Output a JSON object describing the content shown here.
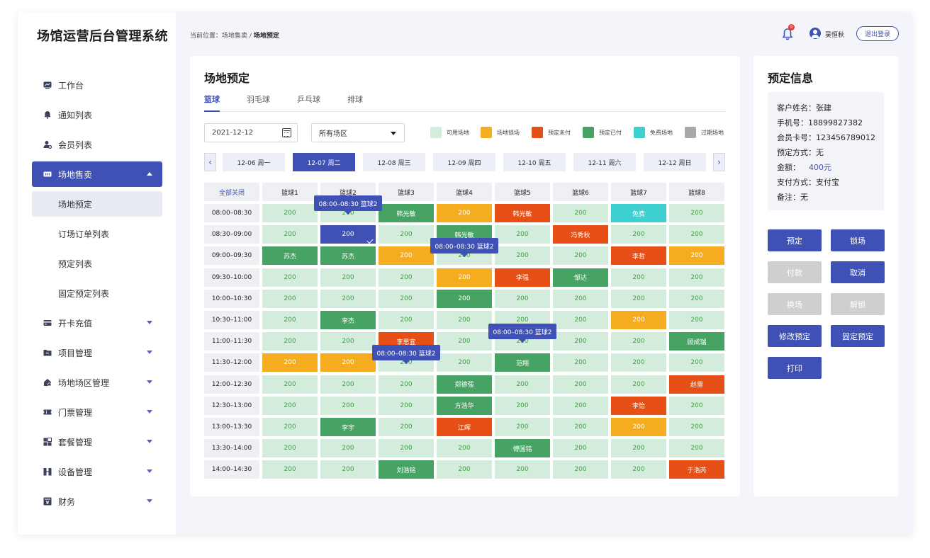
{
  "app": {
    "title": "场馆运营后台管理系统"
  },
  "sidebar": {
    "items": [
      {
        "label": "工作台",
        "icon": "dashboard-icon"
      },
      {
        "label": "通知列表",
        "icon": "bell-icon"
      },
      {
        "label": "会员列表",
        "icon": "member-icon"
      },
      {
        "label": "场地售卖",
        "icon": "ticket-card-icon",
        "active": true
      },
      {
        "label": "开卡充值",
        "icon": "card-icon"
      },
      {
        "label": "项目管理",
        "icon": "folder-icon"
      },
      {
        "label": "场地场区管理",
        "icon": "venue-icon"
      },
      {
        "label": "门票管理",
        "icon": "ticket-icon"
      },
      {
        "label": "套餐管理",
        "icon": "package-icon"
      },
      {
        "label": "设备管理",
        "icon": "device-icon"
      },
      {
        "label": "财务",
        "icon": "finance-icon"
      }
    ],
    "subitems": [
      {
        "label": "场地预定",
        "active": true
      },
      {
        "label": "订场订单列表"
      },
      {
        "label": "预定列表"
      },
      {
        "label": "固定预定列表"
      }
    ]
  },
  "header": {
    "breadcrumb_prefix": "当前位置：",
    "breadcrumb_parent": "场地售卖",
    "breadcrumb_sep": "/",
    "breadcrumb_current": "场地预定",
    "notification_count": "9",
    "user_name": "吴恒秋",
    "logout_label": "退出登录"
  },
  "main": {
    "title": "场地预定",
    "tabs": [
      "篮球",
      "羽毛球",
      "乒乓球",
      "排球"
    ],
    "date_value": "2021-12-12",
    "area_value": "所有场区",
    "legend": [
      {
        "label": "可用场地",
        "color": "#d4ecdc"
      },
      {
        "label": "场地锁场",
        "color": "#f5ac1e"
      },
      {
        "label": "预定未付",
        "color": "#e65016"
      },
      {
        "label": "预定已付",
        "color": "#46a364"
      },
      {
        "label": "免费场地",
        "color": "#3ecfd0"
      },
      {
        "label": "过期场地",
        "color": "#a9a9a9"
      }
    ],
    "prev_day": "‹",
    "next_day": "›",
    "days": [
      "12-06 周一",
      "12-07 周二",
      "12-08 周三",
      "12-09 周四",
      "12-10 周五",
      "12-11 周六",
      "12-12 周日"
    ],
    "active_day": 1,
    "grid": {
      "close_all": "全部关闭",
      "courts": [
        "篮球1",
        "篮球2",
        "篮球3",
        "篮球4",
        "篮球5",
        "篮球6",
        "篮球7",
        "篮球8"
      ],
      "times": [
        "08:00–08:30",
        "08:30–09:00",
        "09:00–09:30",
        "09:30–10:00",
        "10:00–10:30",
        "10:30–11:00",
        "11:00–11:30",
        "11:30–12:00",
        "12:00–12:30",
        "12:30–13:00",
        "13:00–13:30",
        "13:30–14:00",
        "14:00–14:30"
      ],
      "rows": [
        [
          [
            "a",
            "200"
          ],
          [
            "a",
            "200"
          ],
          [
            "p",
            "韩光敏"
          ],
          [
            "l",
            "200"
          ],
          [
            "u",
            "韩光敏"
          ],
          [
            "a",
            "200"
          ],
          [
            "f",
            "免费"
          ],
          [
            "a",
            "200"
          ]
        ],
        [
          [
            "a",
            "200"
          ],
          [
            "s",
            "200"
          ],
          [
            "a",
            "200"
          ],
          [
            "p",
            "韩光敏"
          ],
          [
            "a",
            "200"
          ],
          [
            "u",
            "冯秀秋"
          ],
          [
            "a",
            "200"
          ],
          [
            "a",
            "200"
          ]
        ],
        [
          [
            "p",
            "苏杰"
          ],
          [
            "p",
            "苏杰"
          ],
          [
            "l",
            "200"
          ],
          [
            "a",
            "200"
          ],
          [
            "a",
            "200"
          ],
          [
            "a",
            "200"
          ],
          [
            "u",
            "李哲"
          ],
          [
            "l",
            "200"
          ]
        ],
        [
          [
            "a",
            "200"
          ],
          [
            "a",
            "200"
          ],
          [
            "a",
            "200"
          ],
          [
            "l",
            "200"
          ],
          [
            "u",
            "李强"
          ],
          [
            "p",
            "邹达"
          ],
          [
            "a",
            "200"
          ],
          [
            "a",
            "200"
          ]
        ],
        [
          [
            "a",
            "200"
          ],
          [
            "a",
            "200"
          ],
          [
            "a",
            "200"
          ],
          [
            "p",
            "200"
          ],
          [
            "a",
            "200"
          ],
          [
            "a",
            "200"
          ],
          [
            "a",
            "200"
          ],
          [
            "a",
            "200"
          ]
        ],
        [
          [
            "a",
            "200"
          ],
          [
            "p",
            "李杰"
          ],
          [
            "a",
            "200"
          ],
          [
            "a",
            "200"
          ],
          [
            "a",
            "200"
          ],
          [
            "a",
            "200"
          ],
          [
            "l",
            "200"
          ],
          [
            "a",
            "200"
          ]
        ],
        [
          [
            "a",
            "200"
          ],
          [
            "a",
            "200"
          ],
          [
            "u",
            "李思宜"
          ],
          [
            "a",
            "200"
          ],
          [
            "a",
            "200"
          ],
          [
            "a",
            "200"
          ],
          [
            "a",
            "200"
          ],
          [
            "p",
            "顾成瑞"
          ]
        ],
        [
          [
            "l",
            "200"
          ],
          [
            "l",
            "200"
          ],
          [
            "a",
            "200"
          ],
          [
            "a",
            "200"
          ],
          [
            "p",
            "范翔"
          ],
          [
            "a",
            "200"
          ],
          [
            "a",
            "200"
          ],
          [
            "a",
            "200"
          ]
        ],
        [
          [
            "a",
            "200"
          ],
          [
            "a",
            "200"
          ],
          [
            "a",
            "200"
          ],
          [
            "p",
            "郑德强"
          ],
          [
            "a",
            "200"
          ],
          [
            "a",
            "200"
          ],
          [
            "a",
            "200"
          ],
          [
            "u",
            "赵雷"
          ]
        ],
        [
          [
            "a",
            "200"
          ],
          [
            "a",
            "200"
          ],
          [
            "a",
            "200"
          ],
          [
            "p",
            "方浩华"
          ],
          [
            "a",
            "200"
          ],
          [
            "a",
            "200"
          ],
          [
            "u",
            "李怡"
          ],
          [
            "a",
            "200"
          ]
        ],
        [
          [
            "a",
            "200"
          ],
          [
            "p",
            "李宇"
          ],
          [
            "a",
            "200"
          ],
          [
            "u",
            "江晖"
          ],
          [
            "a",
            "200"
          ],
          [
            "a",
            "200"
          ],
          [
            "l",
            "200"
          ],
          [
            "a",
            "200"
          ]
        ],
        [
          [
            "a",
            "200"
          ],
          [
            "a",
            "200"
          ],
          [
            "a",
            "200"
          ],
          [
            "a",
            "200"
          ],
          [
            "p",
            "傅国铭"
          ],
          [
            "a",
            "200"
          ],
          [
            "a",
            "200"
          ],
          [
            "a",
            "200"
          ]
        ],
        [
          [
            "a",
            "200"
          ],
          [
            "a",
            "200"
          ],
          [
            "p",
            "刘浩铭"
          ],
          [
            "a",
            "200"
          ],
          [
            "a",
            "200"
          ],
          [
            "a",
            "200"
          ],
          [
            "a",
            "200"
          ],
          [
            "u",
            "于浩芮"
          ]
        ]
      ],
      "tooltips": [
        {
          "text": "08:00–08:30 篮球2",
          "row": 0,
          "col": 1
        },
        {
          "text": "08:00–08:30 篮球2",
          "row": 2,
          "col": 3
        },
        {
          "text": "08:00–08:30 篮球2",
          "row": 6,
          "col": 4
        },
        {
          "text": "08:00–08:30 篮球2",
          "row": 7,
          "col": 2
        }
      ]
    }
  },
  "info": {
    "title": "预定信息",
    "rows": [
      {
        "label": "客户姓名：",
        "value": "张建"
      },
      {
        "label": "手机号：",
        "value": "18899827382"
      },
      {
        "label": "会员卡号：",
        "value": "123456789012"
      },
      {
        "label": "预定方式：",
        "value": "无"
      },
      {
        "label": "金额：",
        "value": "400元",
        "money": true
      },
      {
        "label": "支付方式：",
        "value": "支付宝"
      },
      {
        "label": "备注：",
        "value": "无"
      }
    ],
    "actions": [
      {
        "label": "预定",
        "enabled": true
      },
      {
        "label": "锁场",
        "enabled": true
      },
      {
        "label": "付款",
        "enabled": false
      },
      {
        "label": "取消",
        "enabled": true
      },
      {
        "label": "换场",
        "enabled": false
      },
      {
        "label": "解锁",
        "enabled": false
      },
      {
        "label": "修改预定",
        "enabled": true
      },
      {
        "label": "固定预定",
        "enabled": true
      },
      {
        "label": "打印",
        "enabled": true
      }
    ]
  }
}
